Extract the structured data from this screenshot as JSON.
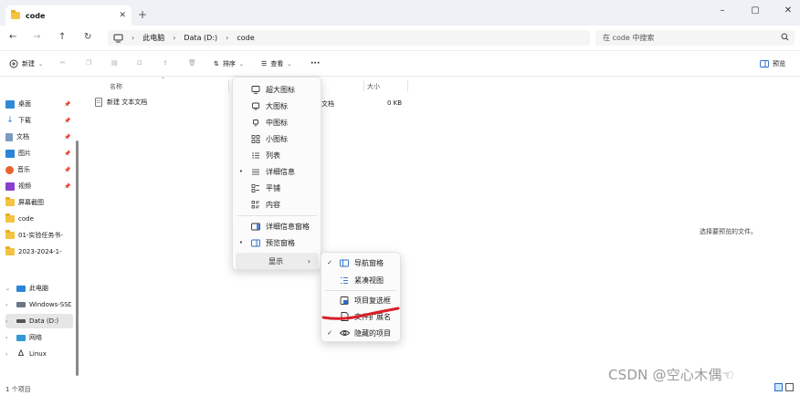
{
  "window": {
    "tab_title": "code",
    "tab_close": "✕",
    "new_tab": "+",
    "minimize": "–",
    "maximize": "▢",
    "close": "✕"
  },
  "address": {
    "back": "←",
    "forward": "→",
    "up": "↑",
    "refresh": "↻",
    "crumbs": [
      "此电脑",
      "Data (D:)",
      "code"
    ],
    "crumb_sep": "›",
    "search_placeholder": "在 code 中搜索"
  },
  "toolbar": {
    "new_label": "新建",
    "sort_label": "排序",
    "view_label": "查看",
    "more_label": "···",
    "preview_label": "预览"
  },
  "sidebar": {
    "quick": [
      {
        "label": "桌面",
        "icon": "desktop-icon",
        "pinned": true
      },
      {
        "label": "下载",
        "icon": "download-icon",
        "pinned": true
      },
      {
        "label": "文档",
        "icon": "documents-icon",
        "pinned": true
      },
      {
        "label": "图片",
        "icon": "pictures-icon",
        "pinned": true
      },
      {
        "label": "音乐",
        "icon": "music-icon",
        "pinned": true
      },
      {
        "label": "视频",
        "icon": "videos-icon",
        "pinned": true
      },
      {
        "label": "屏幕截图",
        "icon": "folder-icon",
        "pinned": false
      },
      {
        "label": "code",
        "icon": "folder-icon",
        "pinned": false
      },
      {
        "label": "01-实验任务书-",
        "icon": "folder-icon",
        "pinned": false
      },
      {
        "label": "2023-2024-1-",
        "icon": "folder-icon",
        "pinned": false
      }
    ],
    "tree": [
      {
        "label": "此电脑",
        "expander": "⌄"
      },
      {
        "label": "Windows-SSD",
        "expander": "›"
      },
      {
        "label": "Data (D:)",
        "expander": "›"
      },
      {
        "label": "网络",
        "expander": "›"
      },
      {
        "label": "Linux",
        "expander": "›"
      }
    ]
  },
  "list": {
    "col_name": "名称",
    "col_size": "大小",
    "file_name": "新建 文本文档",
    "file_type": "文档",
    "file_size": "0 KB"
  },
  "view_menu": {
    "items": [
      {
        "label": "超大图标",
        "icon": "extra-large-icons-icon",
        "check": ""
      },
      {
        "label": "大图标",
        "icon": "large-icons-icon",
        "check": ""
      },
      {
        "label": "中图标",
        "icon": "medium-icons-icon",
        "check": ""
      },
      {
        "label": "小图标",
        "icon": "small-icons-icon",
        "check": ""
      },
      {
        "label": "列表",
        "icon": "list-icon",
        "check": ""
      },
      {
        "label": "详细信息",
        "icon": "details-icon",
        "check": "•"
      },
      {
        "label": "平铺",
        "icon": "tiles-icon",
        "check": ""
      },
      {
        "label": "内容",
        "icon": "content-icon",
        "check": ""
      },
      {
        "label": "详细信息窗格",
        "icon": "details-pane-icon",
        "check": ""
      },
      {
        "label": "预览窗格",
        "icon": "preview-pane-icon",
        "check": "•"
      }
    ],
    "show_label": "显示",
    "show_arrow": "›"
  },
  "show_menu": {
    "items": [
      {
        "label": "导航窗格",
        "icon": "navigation-pane-icon",
        "check": "✓"
      },
      {
        "label": "紧凑视图",
        "icon": "compact-view-icon",
        "check": ""
      },
      {
        "label": "项目复选框",
        "icon": "checkbox-icon",
        "check": ""
      },
      {
        "label": "文件扩展名",
        "icon": "file-extension-icon",
        "check": ""
      },
      {
        "label": "隐藏的项目",
        "icon": "hidden-items-icon",
        "check": "✓"
      }
    ]
  },
  "preview": {
    "empty_text": "选择要预览的文件。"
  },
  "status": {
    "count": "1 个项目"
  },
  "watermark": "CSDN @空心木偶☜",
  "colors": {
    "accent": "#2a6cc4",
    "annotation": "#d9202a",
    "folder": "#f3c441"
  }
}
